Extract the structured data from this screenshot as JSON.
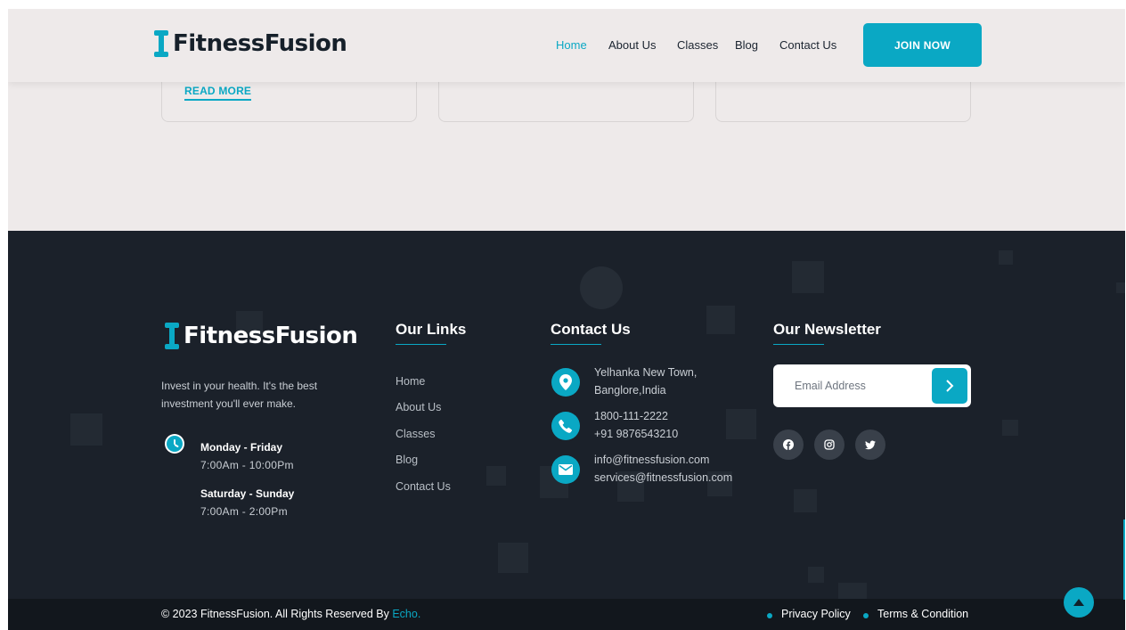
{
  "brand": {
    "name": "FitnessFusion",
    "accent": "#0aa8c4",
    "dark": "#1b212a"
  },
  "header": {
    "nav": [
      {
        "label": "Home",
        "active": true
      },
      {
        "label": "About Us"
      },
      {
        "label": "Classes"
      },
      {
        "label": "Blog"
      },
      {
        "label": "Contact Us"
      }
    ],
    "cta_label": "JOIN NOW"
  },
  "cards": {
    "read_more_label": "READ MORE"
  },
  "footer": {
    "tagline": "Invest in your health. It's the best investment you'll ever make.",
    "hours": [
      {
        "days": "Monday - Friday",
        "time": "7:00Am - 10:00Pm"
      },
      {
        "days": "Saturday - Sunday",
        "time": "7:00Am - 2:00Pm"
      }
    ],
    "links_title": "Our Links",
    "links": [
      "Home",
      "About Us",
      "Classes",
      "Blog",
      "Contact Us"
    ],
    "contact_title": "Contact Us",
    "contact": {
      "address": [
        "Yelhanka New Town,",
        "Banglore,India"
      ],
      "phones": [
        "1800-111-2222",
        "+91 9876543210"
      ],
      "emails": [
        "info@fitnessfusion.com",
        "services@fitnessfusion.com"
      ]
    },
    "newsletter_title": "Our Newsletter",
    "newsletter_placeholder": "Email Address",
    "social_icons": [
      "facebook-icon",
      "instagram-icon",
      "twitter-icon"
    ],
    "copyright": "© 2023 FitnessFusion. All Rights Reserved By ",
    "copyright_brand": "Echo.",
    "legal": [
      "Privacy Policy",
      "Terms & Condition"
    ]
  }
}
